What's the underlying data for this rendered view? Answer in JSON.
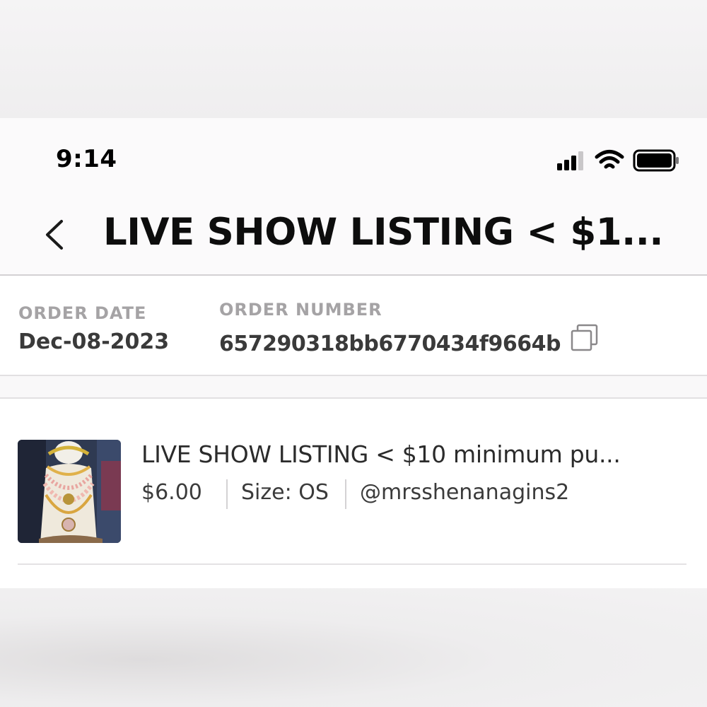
{
  "status_bar": {
    "time": "9:14",
    "icons": [
      "cellular-signal-icon",
      "wifi-icon",
      "battery-icon"
    ]
  },
  "header": {
    "back_icon": "chevron-left-icon",
    "title": "LIVE SHOW LISTING < $1..."
  },
  "order": {
    "date_label": "ORDER DATE",
    "date_value": "Dec-08-2023",
    "number_label": "ORDER NUMBER",
    "number_value": "657290318bb6770434f9664b",
    "copy_icon": "copy-icon"
  },
  "item": {
    "title": "LIVE SHOW LISTING < $10 minimum pu...",
    "price": "$6.00",
    "size": "Size: OS",
    "seller": "@mrsshenanagins2",
    "thumbnail": "jewelry-necklaces-photo"
  },
  "colors": {
    "label_gray": "#a5a3a5",
    "text_dark": "#0d0d0d",
    "divider": "#d3d1d3"
  }
}
